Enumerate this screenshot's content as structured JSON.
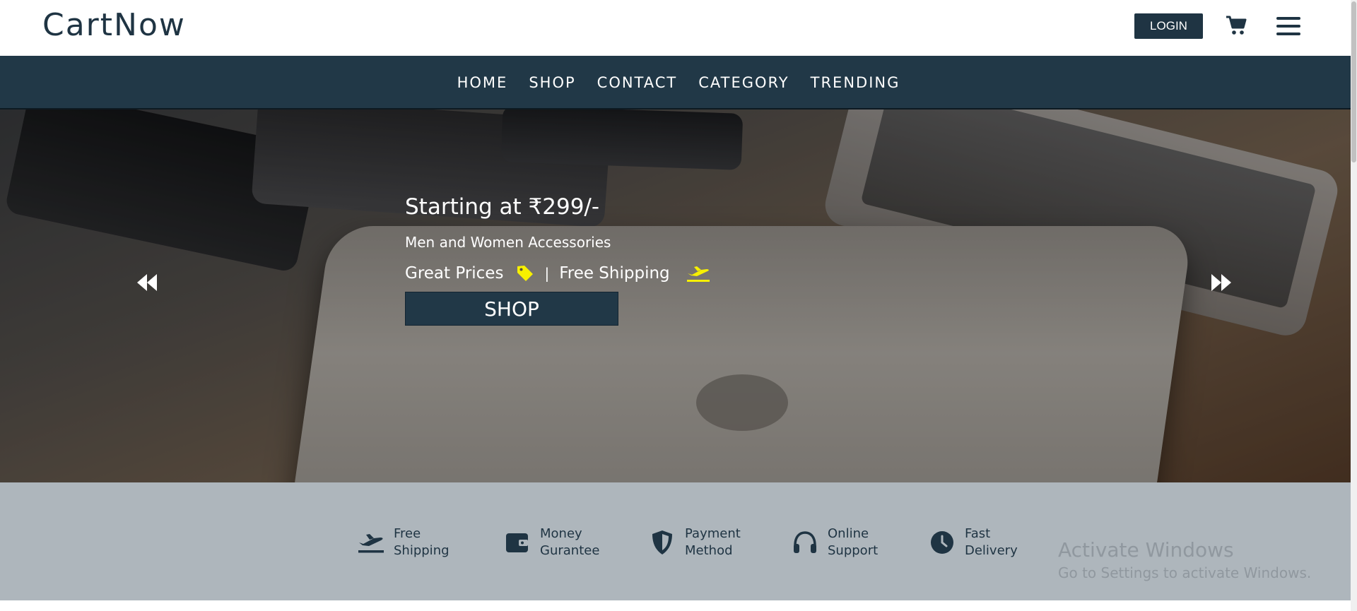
{
  "header": {
    "brand": "CartNow",
    "login_label": "LOGIN",
    "cart_icon": "shopping-cart-icon",
    "menu_icon": "hamburger-menu-icon"
  },
  "nav": {
    "items": [
      {
        "label": "HOME"
      },
      {
        "label": "SHOP"
      },
      {
        "label": "CONTACT"
      },
      {
        "label": "CATEGORY"
      },
      {
        "label": "TRENDING"
      }
    ]
  },
  "hero": {
    "title": "Starting at ₹299/-",
    "subtitle": "Men and Women Accessories",
    "feature_1": "Great Prices",
    "separator": "|",
    "feature_2": "Free Shipping",
    "cta_label": "SHOP",
    "accent_color": "#f7f000",
    "prev_icon": "double-chevron-left-icon",
    "next_icon": "double-chevron-right-icon"
  },
  "features": {
    "items": [
      {
        "label": "Free\nShipping",
        "icon": "plane-departure-icon"
      },
      {
        "label": "Money\nGurantee",
        "icon": "wallet-icon"
      },
      {
        "label": "Payment\nMethod",
        "icon": "shield-icon"
      },
      {
        "label": "Online\nSupport",
        "icon": "headphones-icon"
      },
      {
        "label": "Fast\nDelivery",
        "icon": "clock-icon"
      }
    ]
  },
  "watermark": {
    "title": "Activate Windows",
    "subtitle": "Go to Settings to activate Windows."
  },
  "colors": {
    "brand_dark": "#213847",
    "strip_bg": "#aeb6bc",
    "white": "#ffffff"
  }
}
